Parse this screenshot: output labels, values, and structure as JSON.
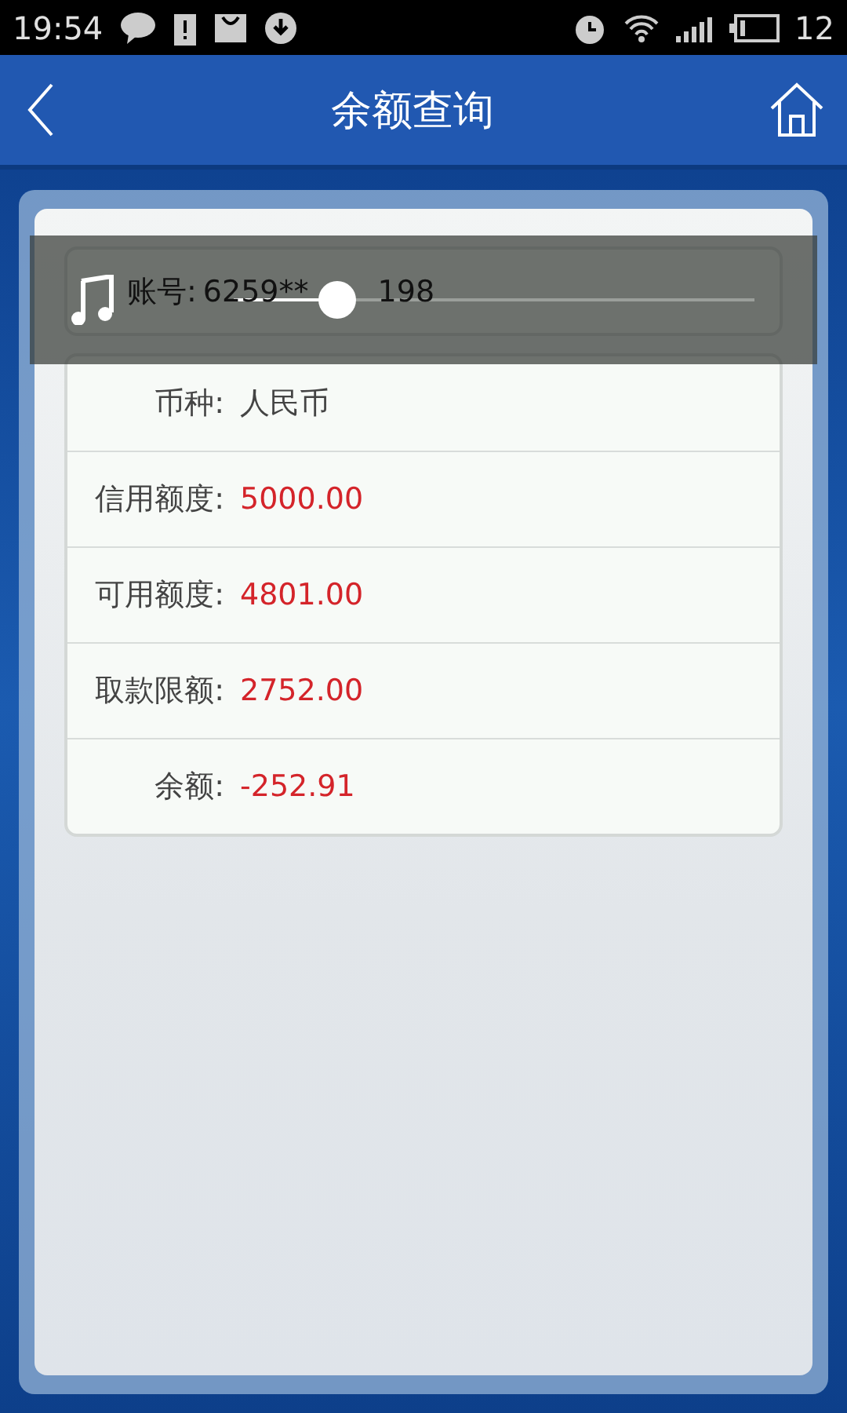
{
  "status_bar": {
    "time": "19:54",
    "battery": "12"
  },
  "header": {
    "title": "余额查询"
  },
  "account": {
    "label": "账号:",
    "value_start": "6259**",
    "value_end": "198"
  },
  "details": [
    {
      "label": "币种:",
      "value": "人民币",
      "kind": "plain"
    },
    {
      "label": "信用额度:",
      "value": "5000.00",
      "kind": "amount"
    },
    {
      "label": "可用额度:",
      "value": "4801.00",
      "kind": "amount"
    },
    {
      "label": "取款限额:",
      "value": "2752.00",
      "kind": "amount"
    },
    {
      "label": "余额:",
      "value": "-252.91",
      "kind": "amount"
    }
  ],
  "volume_overlay": {
    "level": 0.2
  }
}
